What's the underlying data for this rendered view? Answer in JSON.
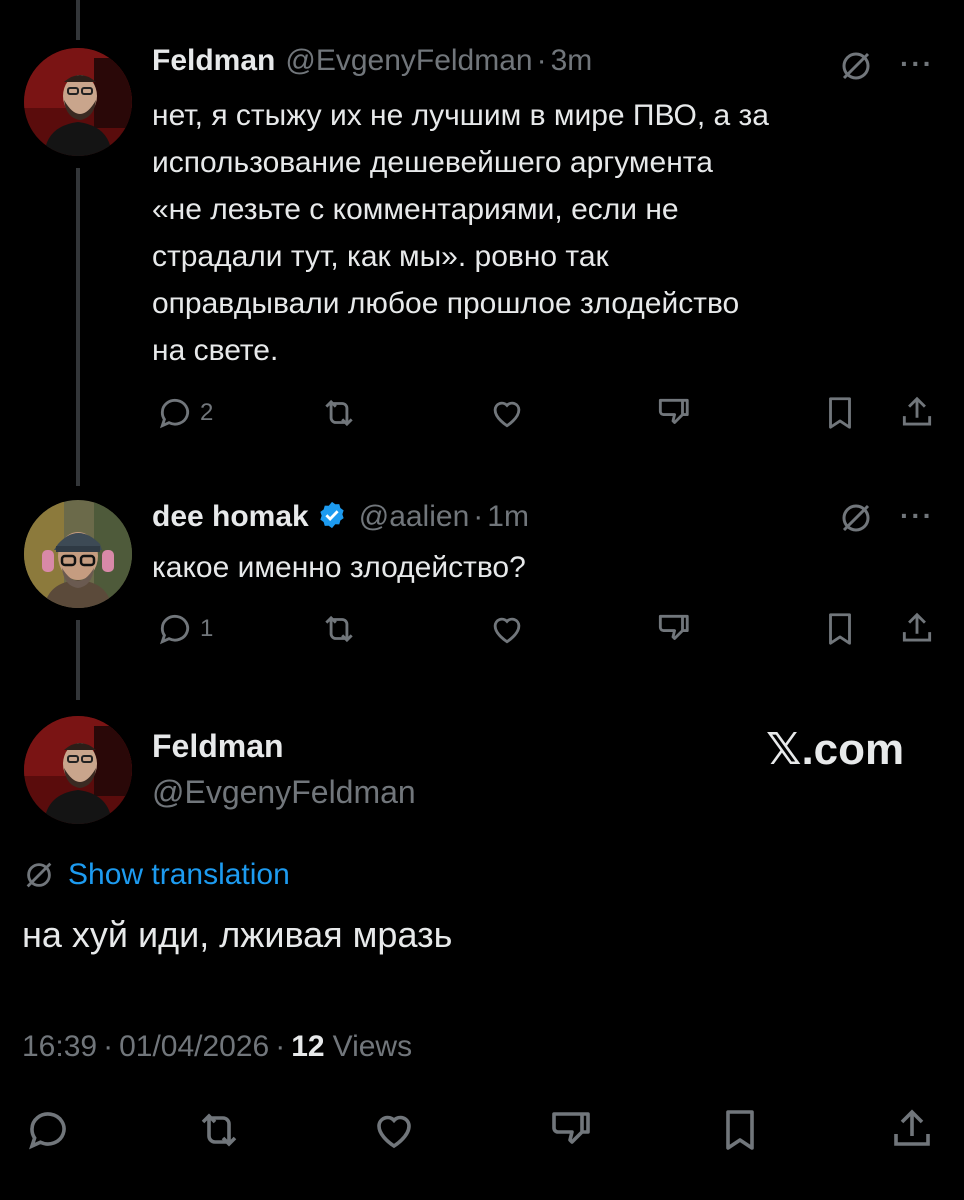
{
  "tweet1": {
    "display_name": "Feldman",
    "handle": "@EvgenyFeldman",
    "separator": "·",
    "time": "3m",
    "text_lines": [
      "нет, я стыжу их не лучшим в мире ПВО, а за",
      "использование дешевейшего аргумента",
      "«не лезьте с комментариями, если не",
      "страдали тут, как мы». ровно так",
      "оправдывали любое прошлое злодейство",
      "на свете."
    ],
    "reply_count": "2",
    "more": "···"
  },
  "tweet2": {
    "display_name": "dee homak",
    "handle": "@aalien",
    "separator": "·",
    "time": "1m",
    "text": "какое именно злодейство?",
    "reply_count": "1",
    "more": "···"
  },
  "main": {
    "display_name": "Feldman",
    "handle": "@EvgenyFeldman",
    "watermark": "𝕏.com",
    "show_translation": "Show translation",
    "text": "на хуй иди, лживая мразь",
    "time": "16:39",
    "sep1": "·",
    "date": "01/04/2026",
    "sep2": "·",
    "views_count": "12",
    "views_label": "Views"
  },
  "colors": {
    "background": "#000000",
    "text": "#e7e9ea",
    "muted": "#71767b",
    "link": "#1d9bf0",
    "verified": "#1d9bf0"
  },
  "icons": [
    "reply-icon",
    "retweet-icon",
    "like-icon",
    "dislike-icon",
    "bookmark-icon",
    "share-icon",
    "grok-icon",
    "verified-badge-icon"
  ]
}
